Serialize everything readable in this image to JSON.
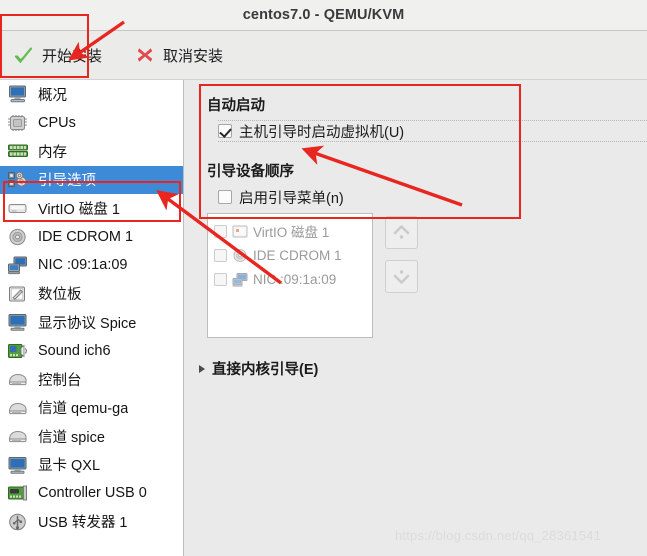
{
  "window": {
    "title": "centos7.0 - QEMU/KVM"
  },
  "toolbar": {
    "begin_install_label": "开始安装",
    "begin_install_icon": "green-check-icon",
    "cancel_install_label": "取消安装",
    "cancel_install_icon": "red-x-icon"
  },
  "sidebar": {
    "selected_index": 3,
    "items": [
      {
        "label": "概况",
        "icon": "monitor-icon"
      },
      {
        "label": "CPUs",
        "icon": "cpu-chip-icon"
      },
      {
        "label": "内存",
        "icon": "memory-ram-icon"
      },
      {
        "label": "引导选项",
        "icon": "boot-options-icon"
      },
      {
        "label": "VirtIO 磁盘 1",
        "icon": "harddisk-icon"
      },
      {
        "label": "IDE CDROM 1",
        "icon": "cdrom-icon"
      },
      {
        "label": "NIC :09:1a:09",
        "icon": "network-card-icon"
      },
      {
        "label": "数位板",
        "icon": "tablet-pen-icon"
      },
      {
        "label": "显示协议 Spice",
        "icon": "display-icon"
      },
      {
        "label": "Sound ich6",
        "icon": "sound-card-icon"
      },
      {
        "label": "控制台",
        "icon": "console-icon"
      },
      {
        "label": "信道 qemu-ga",
        "icon": "channel-icon"
      },
      {
        "label": "信道 spice",
        "icon": "channel-icon"
      },
      {
        "label": "显卡 QXL",
        "icon": "video-card-icon"
      },
      {
        "label": "Controller USB 0",
        "icon": "usb-controller-icon"
      },
      {
        "label": "USB 转发器 1",
        "icon": "usb-redirector-icon"
      }
    ]
  },
  "main": {
    "autostart": {
      "group_title": "自动启动",
      "checkbox_label": "主机引导时启动虚拟机(U)",
      "checkbox_checked": true
    },
    "boot_order": {
      "group_title": "引导设备顺序",
      "enable_menu_label": "启用引导菜单(n)",
      "enable_menu_checked": false,
      "devices": [
        {
          "label": "VirtIO 磁盘 1",
          "icon": "harddisk-icon",
          "checked": false
        },
        {
          "label": "IDE CDROM 1",
          "icon": "cdrom-icon",
          "checked": false
        },
        {
          "label": "NIC :09:1a:09",
          "icon": "network-card-icon",
          "checked": false
        }
      ],
      "move_up_icon": "chevron-double-up-icon",
      "move_down_icon": "chevron-double-down-icon"
    },
    "direct_kernel_boot": {
      "label": "直接内核引导(E)",
      "expanded": false,
      "icon": "expander-triangle-icon"
    }
  },
  "watermark": {
    "text": "https://blog.csdn.net/qq_28361541"
  },
  "annotations": {
    "accent_color": "#e8251f",
    "boxes": [
      {
        "name": "toolbar-highlight"
      },
      {
        "name": "sidebar-boot-options-highlight"
      },
      {
        "name": "autostart-section-highlight"
      }
    ],
    "arrows": [
      {
        "name": "arrow-to-begin-install"
      },
      {
        "name": "arrow-to-autostart-checkbox"
      },
      {
        "name": "arrow-to-boot-options-item"
      }
    ]
  },
  "theme": {
    "selection_blue": "#3d8ad8",
    "panel_gray": "#eaeaea",
    "list_white": "#ffffff"
  }
}
